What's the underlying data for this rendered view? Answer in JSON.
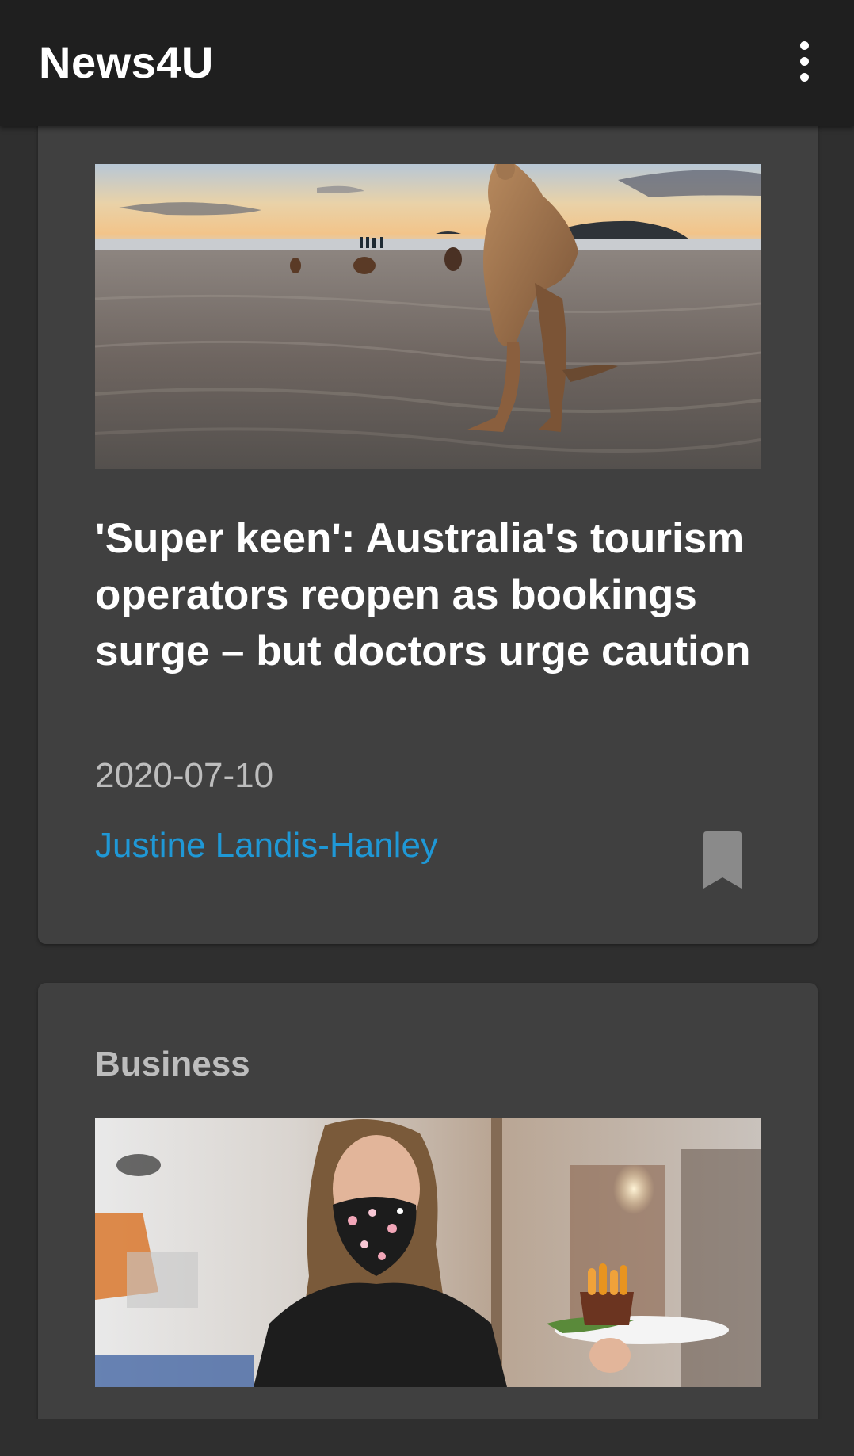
{
  "app": {
    "title": "News4U",
    "menu_icon": "more-vert-icon"
  },
  "articles": [
    {
      "image_desc": "kangaroo-on-beach-photo",
      "headline": "'Super keen': Australia's tourism operators reopen as bookings surge – but doctors urge caution",
      "date": "2020-07-10",
      "author": "Justine Landis-Hanley",
      "bookmark_icon": "bookmark-icon"
    },
    {
      "category": "Business",
      "image_desc": "masked-waitress-serving-food-photo"
    }
  ],
  "colors": {
    "appbar": "#1f1f1f",
    "background": "#2f2f2f",
    "card": "#404040",
    "author_link": "#1f98d6",
    "meta_text": "#bdbdbd"
  }
}
